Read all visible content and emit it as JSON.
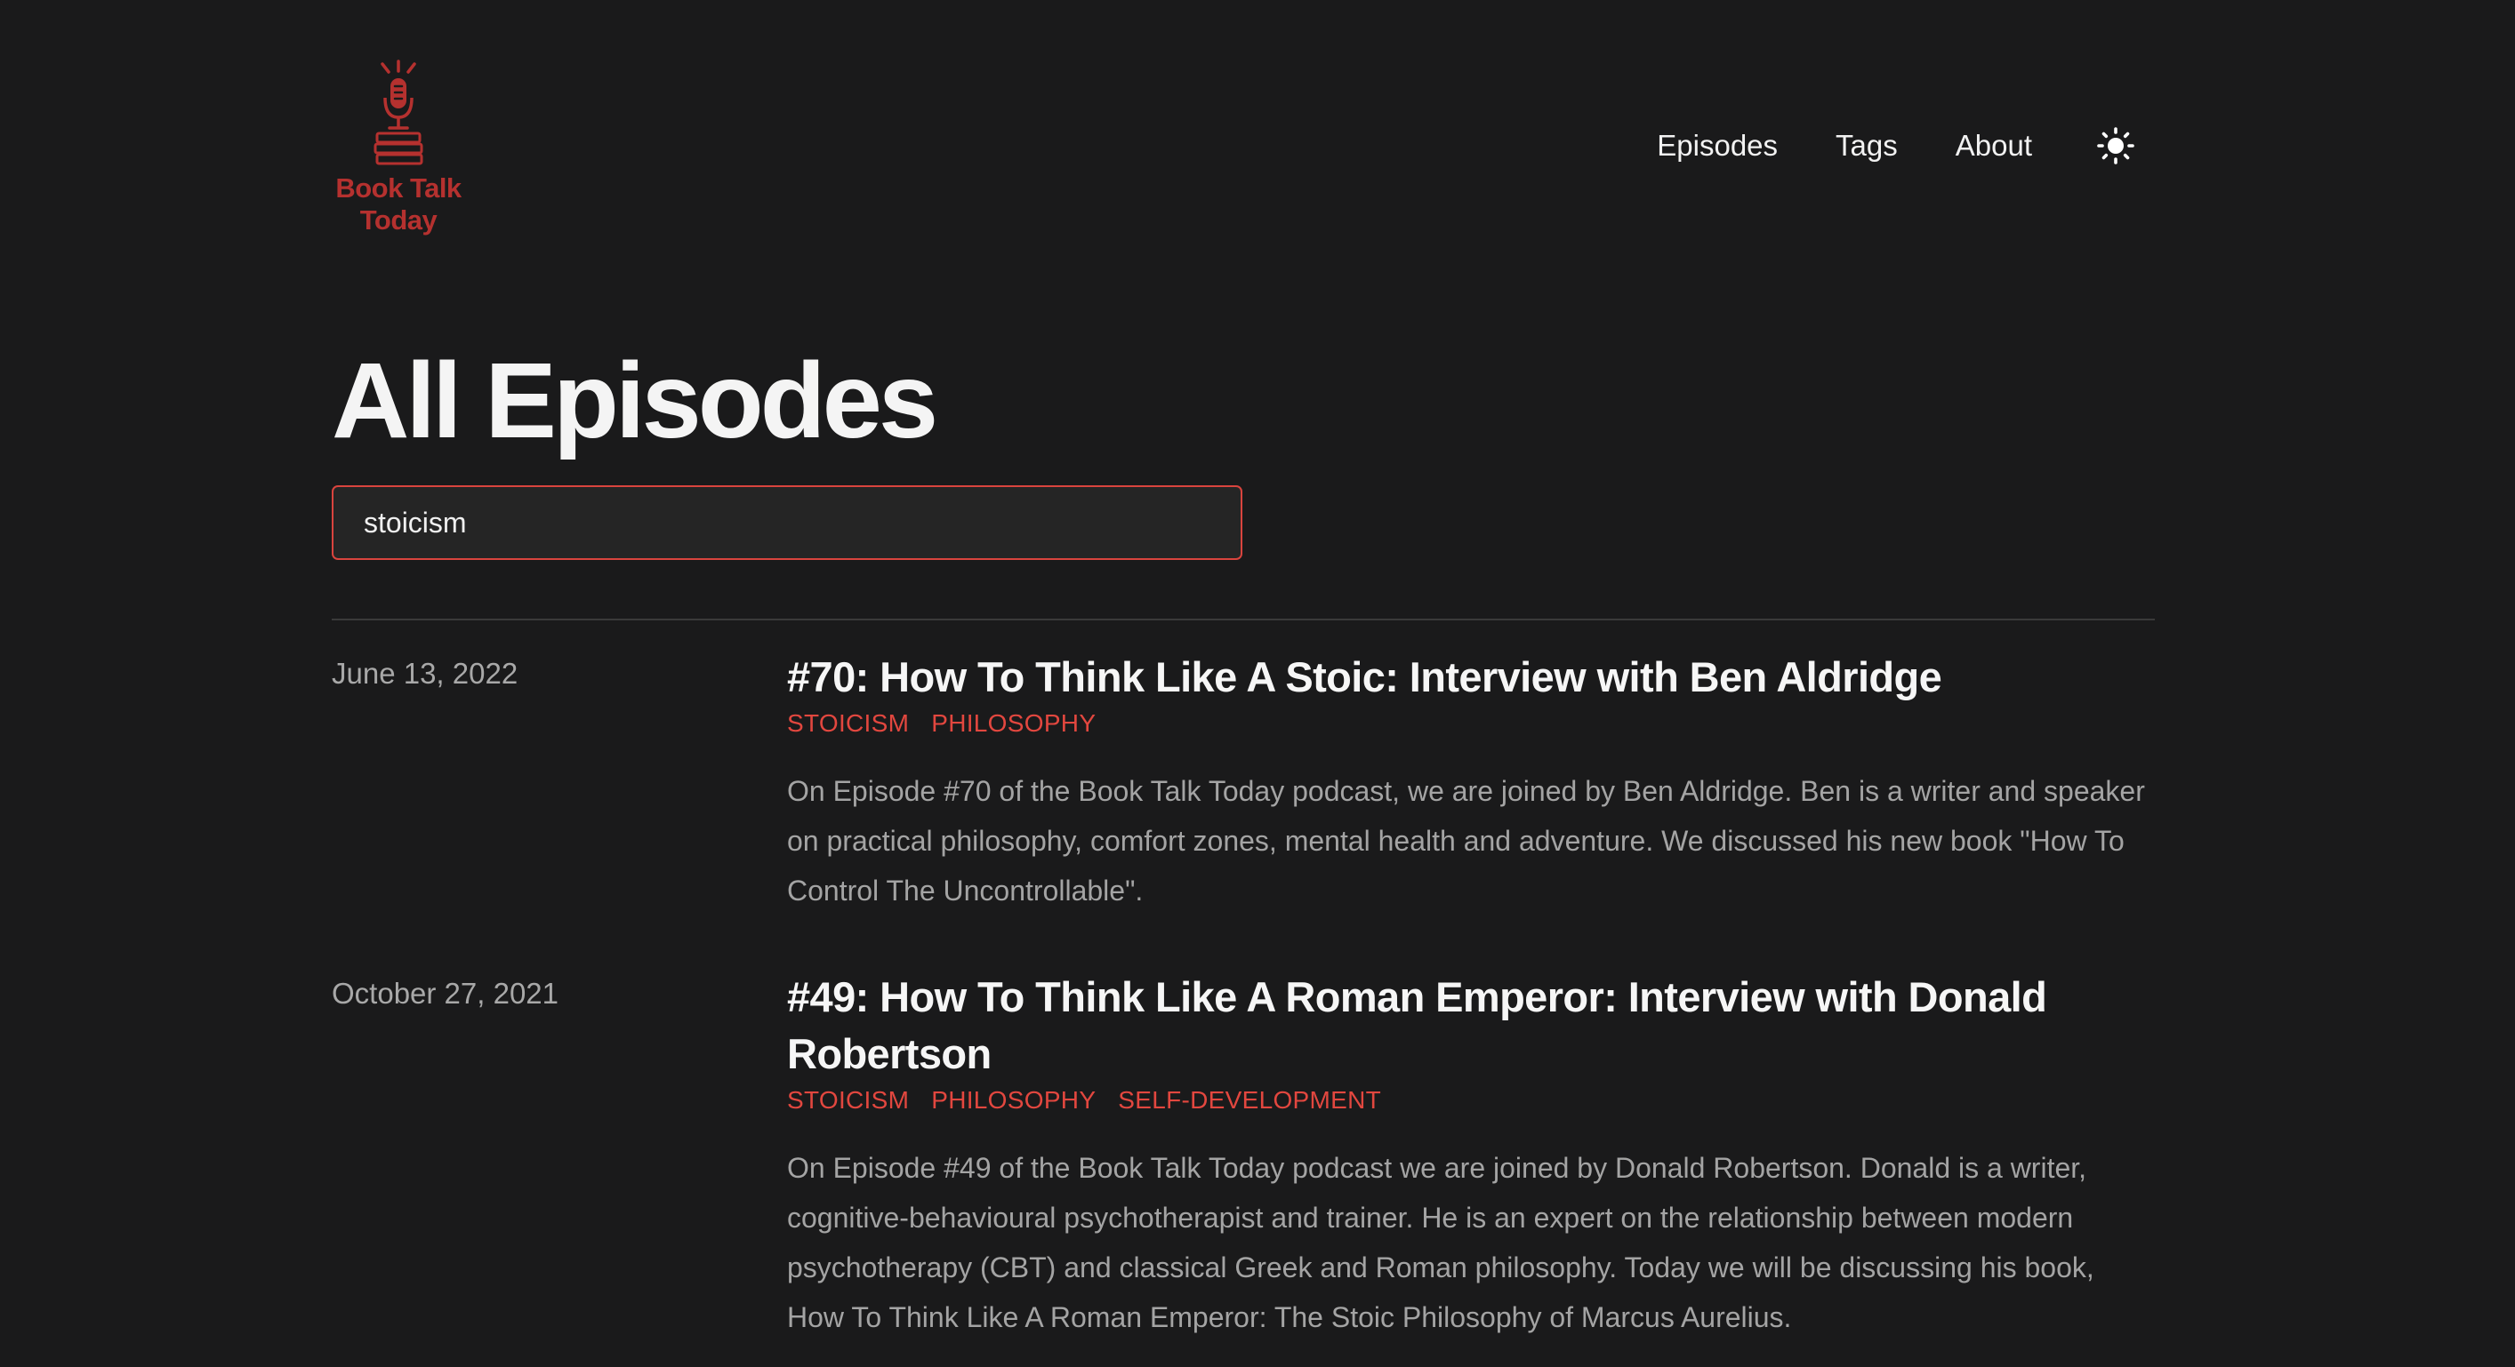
{
  "brand": {
    "logo_text_line1": "Book Talk",
    "logo_text_line2": "Today",
    "accent_color": "#b5312f"
  },
  "nav": {
    "items": [
      {
        "label": "Episodes"
      },
      {
        "label": "Tags"
      },
      {
        "label": "About"
      }
    ],
    "theme_toggle_icon": "sun-icon"
  },
  "page": {
    "title": "All Episodes"
  },
  "search": {
    "value": "stoicism",
    "placeholder": ""
  },
  "episodes": [
    {
      "date": "June 13, 2022",
      "title": "#70: How To Think Like A Stoic: Interview with Ben Aldridge",
      "tags": [
        "Stoicism",
        "Philosophy"
      ],
      "description": "On Episode #70 of the Book Talk Today podcast, we are joined by Ben Aldridge. Ben is a writer and speaker on practical philosophy, comfort zones, mental health and adventure. We discussed his new book \"How To Control The Uncontrollable\"."
    },
    {
      "date": "October 27, 2021",
      "title": "#49: How To Think Like A Roman Emperor: Interview with Donald Robertson",
      "tags": [
        "Stoicism",
        "Philosophy",
        "Self-Development"
      ],
      "description": "On Episode #49 of the Book Talk Today podcast we are joined by Donald Robertson. Donald is a writer, cognitive-behavioural psychotherapist and trainer. He is an expert on the relationship between modern psychotherapy (CBT) and classical Greek and Roman philosophy. Today we will be discussing his book, How To Think Like A Roman Emperor: The Stoic Philosophy of Marcus Aurelius."
    }
  ]
}
